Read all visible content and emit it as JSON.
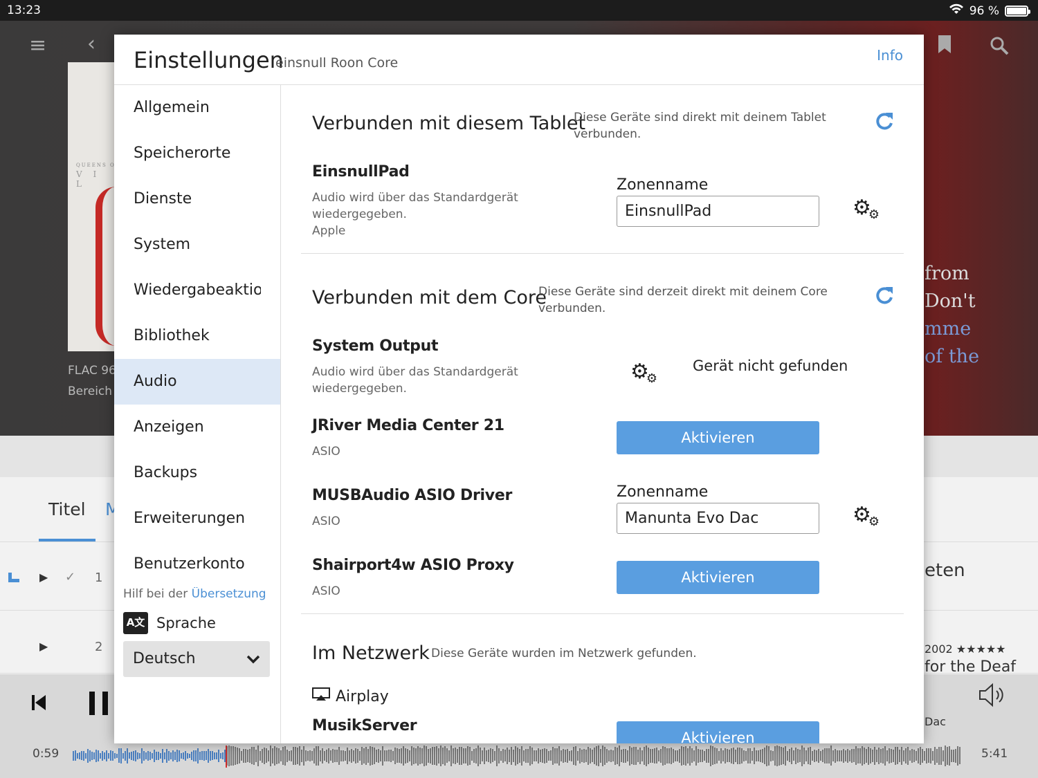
{
  "statusbar": {
    "time": "13:23",
    "battery_text": "96 %"
  },
  "background": {
    "format_text": "FLAC 96",
    "range_text": "Bereich",
    "right_lines": [
      "from",
      "Don't",
      "mme",
      "of the"
    ],
    "tab_titel": "Titel",
    "tab_partial": "M",
    "row1_num": "1",
    "row2_num": "2",
    "right_list_text": "eten",
    "right_year": "2002 ★★★★★",
    "right_album": "for the Deaf",
    "right_zone": "Dac",
    "time_elapsed": "0:59",
    "time_total": "5:41"
  },
  "modal": {
    "title": "Einstellungen",
    "subtitle": "einsnull Roon Core",
    "info_link": "Info"
  },
  "sidebar": {
    "items": [
      {
        "label": "Allgemein"
      },
      {
        "label": "Speicherorte"
      },
      {
        "label": "Dienste"
      },
      {
        "label": "System"
      },
      {
        "label": "Wiedergabeaktionen"
      },
      {
        "label": "Bibliothek"
      },
      {
        "label": "Audio"
      },
      {
        "label": "Anzeigen"
      },
      {
        "label": "Backups"
      },
      {
        "label": "Erweiterungen"
      },
      {
        "label": "Benutzerkonto"
      }
    ],
    "help_prefix": "Hilf bei der ",
    "help_link": "Übersetzung",
    "language_icon": "A文",
    "language_label": "Sprache",
    "language_value": "Deutsch"
  },
  "sections": {
    "tablet": {
      "title": "Verbunden mit diesem Tablet",
      "desc": "Diese Geräte sind direkt mit deinem Tablet verbunden.",
      "device": {
        "name": "EinsnullPad",
        "desc": "Audio wird über das Standardgerät wiedergegeben.",
        "vendor": "Apple",
        "zone_label": "Zonenname",
        "zone_value": "EinsnullPad"
      }
    },
    "core": {
      "title": "Verbunden mit dem Core",
      "desc": "Diese Geräte sind derzeit direkt mit deinem Core verbunden.",
      "devices": [
        {
          "name": "System Output",
          "desc": "Audio wird über das Standardgerät wiedergegeben.",
          "status": "Gerät nicht gefunden"
        },
        {
          "name": "JRiver Media Center 21",
          "desc": "ASIO",
          "button": "Aktivieren"
        },
        {
          "name": "MUSBAudio ASIO Driver",
          "desc": "ASIO",
          "zone_label": "Zonenname",
          "zone_value": "Manunta Evo Dac"
        },
        {
          "name": "Shairport4w ASIO Proxy",
          "desc": "ASIO",
          "button": "Aktivieren"
        }
      ]
    },
    "network": {
      "title": "Im Netzwerk",
      "desc": "Diese Geräte wurden im Netzwerk gefunden.",
      "group": "Airplay",
      "device": {
        "name": "MusikServer",
        "button": "Aktivieren"
      }
    }
  },
  "colors": {
    "accent": "#4a8fd4",
    "button": "#5a9ee0",
    "selected_nav": "#dde8f6"
  }
}
